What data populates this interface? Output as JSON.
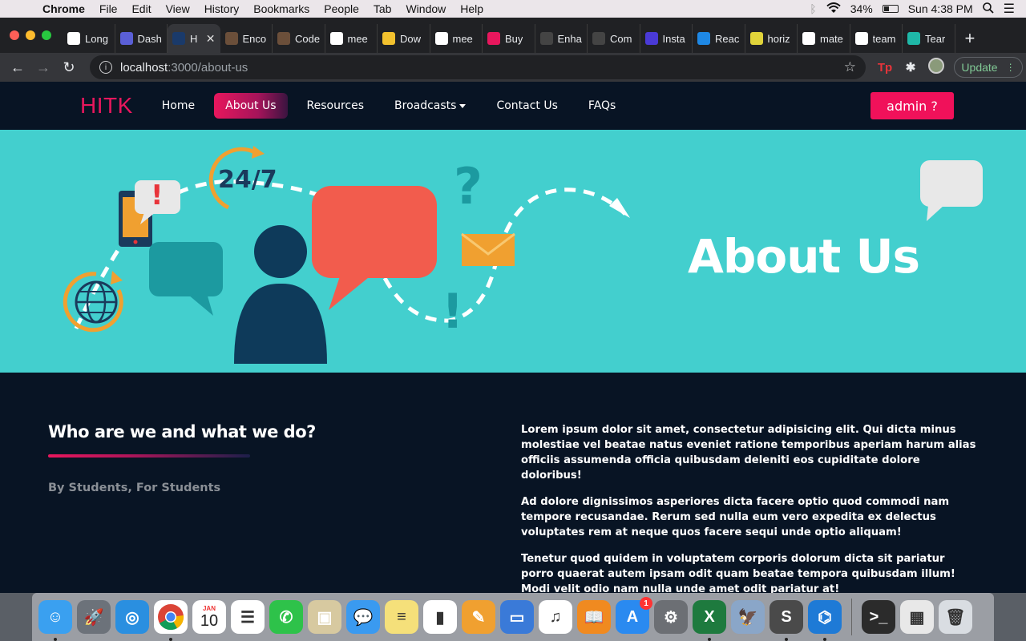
{
  "menubar": {
    "app_name": "Chrome",
    "items": [
      "File",
      "Edit",
      "View",
      "History",
      "Bookmarks",
      "People",
      "Tab",
      "Window",
      "Help"
    ],
    "battery": "34%",
    "clock": "Sun 4:38 PM"
  },
  "tabs": [
    {
      "label": "Long",
      "icon": "amazon-icon",
      "color": "#ffffff"
    },
    {
      "label": "Dash",
      "icon": "dashboard-icon",
      "color": "#5a5fd6"
    },
    {
      "label": "H",
      "icon": "app-icon",
      "color": "#1a3a6a"
    },
    {
      "label": "Enco",
      "icon": "codechef-icon",
      "color": "#6b4f3a"
    },
    {
      "label": "Code",
      "icon": "codechef-icon",
      "color": "#6b4f3a"
    },
    {
      "label": "mee",
      "icon": "google-icon",
      "color": "#ffffff"
    },
    {
      "label": "Dow",
      "icon": "docs-icon",
      "color": "#f2c12e"
    },
    {
      "label": "mee",
      "icon": "google-icon",
      "color": "#ffffff"
    },
    {
      "label": "Buy",
      "icon": "myntra-icon",
      "color": "#e8175d"
    },
    {
      "label": "Enha",
      "icon": "github-icon",
      "color": "#444444"
    },
    {
      "label": "Com",
      "icon": "github-icon",
      "color": "#444444"
    },
    {
      "label": "Insta",
      "icon": "grid-icon",
      "color": "#4a3ad6"
    },
    {
      "label": "Reac",
      "icon": "mui-icon",
      "color": "#1e88e5"
    },
    {
      "label": "horiz",
      "icon": "spark-icon",
      "color": "#e0d33a"
    },
    {
      "label": "mate",
      "icon": "google-icon",
      "color": "#ffffff"
    },
    {
      "label": "team",
      "icon": "google-icon",
      "color": "#ffffff"
    },
    {
      "label": "Tear",
      "icon": "c-icon",
      "color": "#1fb8a8"
    }
  ],
  "active_tab_index": 2,
  "address": {
    "host": "localhost",
    "path": ":3000/about-us"
  },
  "update_label": "Update",
  "site": {
    "brand": "HITK",
    "nav": [
      "Home",
      "About Us",
      "Resources",
      "Broadcasts",
      "Contact Us",
      "FAQs"
    ],
    "active_nav": "About Us",
    "admin_label": "admin ?",
    "hero_title": "About Us",
    "hero_text": {
      "clock": "24/7",
      "question": "?",
      "exclaim": "!"
    },
    "section_title": "Who are we and what we do?",
    "tagline": "By Students, For Students",
    "paragraphs": [
      "Lorem ipsum dolor sit amet, consectetur adipisicing elit. Qui dicta minus molestiae vel beatae natus eveniet ratione temporibus aperiam harum alias officiis assumenda officia quibusdam deleniti eos cupiditate dolore doloribus!",
      "Ad dolore dignissimos asperiores dicta facere optio quod commodi nam tempore recusandae. Rerum sed nulla eum vero expedita ex delectus voluptates rem at neque quos facere sequi unde optio aliquam!",
      "Tenetur quod quidem in voluptatem corporis dolorum dicta sit pariatur porro quaerat autem ipsam odit quam beatae tempora quibusdam illum! Modi velit odio nam nulla unde amet odit pariatur at!"
    ]
  },
  "colors": {
    "accent": "#e8175d",
    "hero_bg": "#43cfce",
    "page_bg": "#081424"
  },
  "dock": {
    "calendar_month": "JAN",
    "calendar_day": "10",
    "appstore_badge": "1",
    "apps": [
      {
        "name": "finder-icon",
        "color": "#3aa0f0",
        "glyph": "☺",
        "running": true
      },
      {
        "name": "launchpad-icon",
        "color": "#6c727a",
        "glyph": "🚀",
        "running": false
      },
      {
        "name": "safari-icon",
        "color": "#2a8fe0",
        "glyph": "◎",
        "running": false
      },
      {
        "name": "chrome-icon",
        "color": "#ffffff",
        "glyph": "",
        "running": true
      },
      {
        "name": "calendar-icon",
        "color": "#ffffff",
        "glyph": "",
        "running": false
      },
      {
        "name": "reminders-icon",
        "color": "#ffffff",
        "glyph": "☰",
        "running": false
      },
      {
        "name": "facetime-icon",
        "color": "#2ec24a",
        "glyph": "✆",
        "running": false
      },
      {
        "name": "preview-icon",
        "color": "#d7c9a0",
        "glyph": "▣",
        "running": false
      },
      {
        "name": "messages-icon",
        "color": "#3a9af0",
        "glyph": "💬",
        "running": false
      },
      {
        "name": "notes-icon",
        "color": "#f5e07a",
        "glyph": "≡",
        "running": false
      },
      {
        "name": "numbers-icon",
        "color": "#ffffff",
        "glyph": "▮",
        "running": false
      },
      {
        "name": "pages-icon",
        "color": "#f0a030",
        "glyph": "✎",
        "running": false
      },
      {
        "name": "keynote-icon",
        "color": "#3a7ad8",
        "glyph": "▭",
        "running": false
      },
      {
        "name": "itunes-icon",
        "color": "#ffffff",
        "glyph": "♫",
        "running": false
      },
      {
        "name": "books-icon",
        "color": "#f08a20",
        "glyph": "📖",
        "running": false
      },
      {
        "name": "appstore-icon",
        "color": "#2a8af0",
        "glyph": "A",
        "running": false
      },
      {
        "name": "system-preferences-icon",
        "color": "#6c6f74",
        "glyph": "⚙",
        "running": false
      },
      {
        "name": "excel-icon",
        "color": "#1e7a3e",
        "glyph": "X",
        "running": true
      },
      {
        "name": "preview-2-icon",
        "color": "#8aa6c8",
        "glyph": "🦅",
        "running": false
      },
      {
        "name": "sublime-icon",
        "color": "#4a4a4a",
        "glyph": "S",
        "running": true
      },
      {
        "name": "vscode-icon",
        "color": "#1e7ad6",
        "glyph": "⌬",
        "running": true
      }
    ],
    "extra_apps": [
      {
        "name": "terminal-icon",
        "color": "#2b2b2b",
        "glyph": ">_"
      },
      {
        "name": "screenshot-icon",
        "color": "#e8e8e8",
        "glyph": "▦"
      },
      {
        "name": "trash-icon",
        "color": "#d9dde2",
        "glyph": "🗑"
      }
    ]
  }
}
